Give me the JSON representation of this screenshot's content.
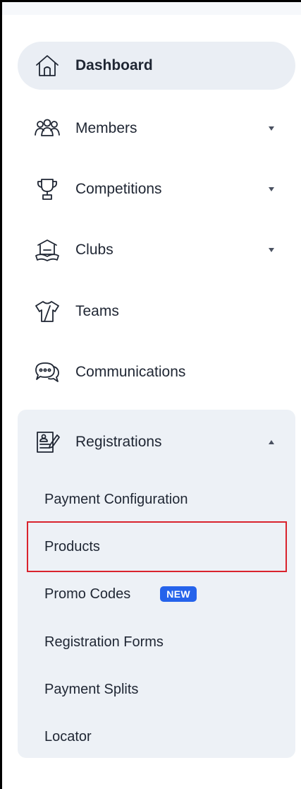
{
  "nav": {
    "dashboard": {
      "label": "Dashboard",
      "icon": "home-icon"
    },
    "members": {
      "label": "Members",
      "icon": "members-icon"
    },
    "competitions": {
      "label": "Competitions",
      "icon": "trophy-icon"
    },
    "clubs": {
      "label": "Clubs",
      "icon": "club-building-icon"
    },
    "teams": {
      "label": "Teams",
      "icon": "jersey-icon"
    },
    "communications": {
      "label": "Communications",
      "icon": "chat-bubbles-icon"
    },
    "registrations": {
      "label": "Registrations",
      "icon": "registration-form-icon",
      "expanded": true,
      "items": [
        {
          "label": "Payment Configuration"
        },
        {
          "label": "Products"
        },
        {
          "label": "Promo Codes",
          "badge": "NEW"
        },
        {
          "label": "Registration Forms"
        },
        {
          "label": "Payment Splits"
        },
        {
          "label": "Locator"
        }
      ]
    }
  },
  "colors": {
    "active_bg": "#eaeef4",
    "panel_bg": "#edf1f6",
    "text": "#1f2633",
    "badge": "#2563eb",
    "highlight": "#d9232d"
  }
}
